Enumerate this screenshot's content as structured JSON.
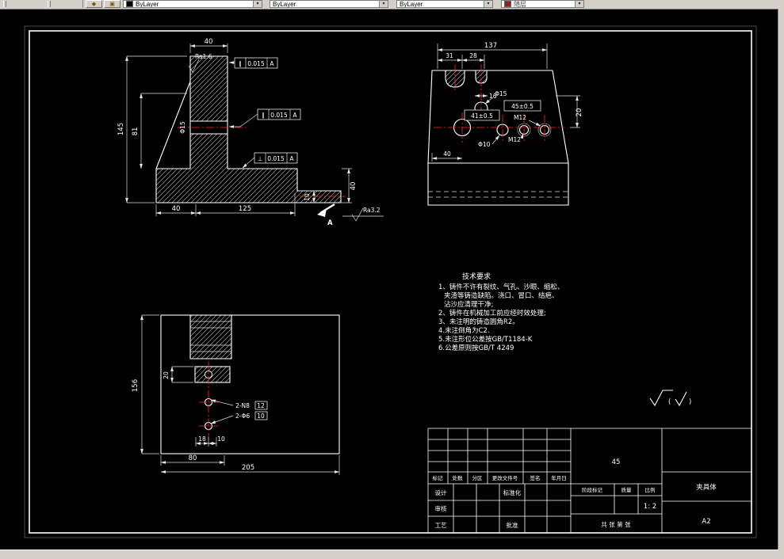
{
  "toolbar": {
    "icon1": "◆",
    "icon2": "▣",
    "color": "ByLayer",
    "linetype": "ByLayer",
    "lineweight": "ByLayer",
    "plot_style": "随层",
    "arrow": "▾"
  },
  "front_view": {
    "dim_top": "40",
    "ra_top": "Ra1.6",
    "fcf1": {
      "sym": "∥",
      "tol": "0.015",
      "datum": "A"
    },
    "fcf2": {
      "sym": "∥",
      "tol": "0.015",
      "datum": "A"
    },
    "fcf3": {
      "sym": "⊥",
      "tol": "0.015",
      "datum": "A"
    },
    "dim_145": "145",
    "dim_81": "81",
    "dim_phi15": "Φ15",
    "dim_40_left": "40",
    "dim_125": "125",
    "dim_40_right": "40",
    "dim_10": "10",
    "ra_bottom": "Ra3.2",
    "section": "A"
  },
  "top_view": {
    "dim_137": "137",
    "dim_31": "31",
    "dim_28": "28",
    "dim_16": "16",
    "phi15": "Φ15",
    "dim_41": "41±0.5",
    "dim_45": "45±0.5",
    "m12_a": "M12",
    "m12_b": "M12",
    "phi10": "Φ10",
    "dim_40": "40",
    "dim_20": "20"
  },
  "plan_view": {
    "dim_156": "156",
    "dim_20": "20",
    "note_n8": "2-N8",
    "note_n8_depth": "12",
    "note_d6": "2-Φ6",
    "note_d6_depth": "10",
    "dim_18": "18",
    "dim_10": "10",
    "dim_80": "80",
    "dim_205": "205"
  },
  "tech_req": {
    "title": "技术要求",
    "lines": [
      "1、铸件不许有裂纹、气孔、沙眼、缩松、",
      "夹渣等铸造缺陷。浇口、冒口、结疤、",
      "沾沙应清理干净;",
      "2、铸件在机械加工前应经时效处理;",
      "3、未注明的铸造圆角R2。",
      "4.未注倒角为C2.",
      "5.未注形位公差按GB/T1184-K",
      "6.公差原则按GB/T 4249"
    ]
  },
  "surface_note": {
    "open": "(",
    "close": ")"
  },
  "title_block": {
    "material": "45",
    "part_name": "夹具体",
    "sheet": "A2",
    "scale_value": "1: 2",
    "header": [
      "标记",
      "处数",
      "分区",
      "更改文件号",
      "签名",
      "年月日"
    ],
    "design": "设计",
    "check": "审核",
    "process": "工艺",
    "standard": "标准化",
    "approve": "批准",
    "stage": "阶段标记",
    "mass": "质量",
    "scale_label": "比例",
    "sheets": "共  张  第  张"
  }
}
